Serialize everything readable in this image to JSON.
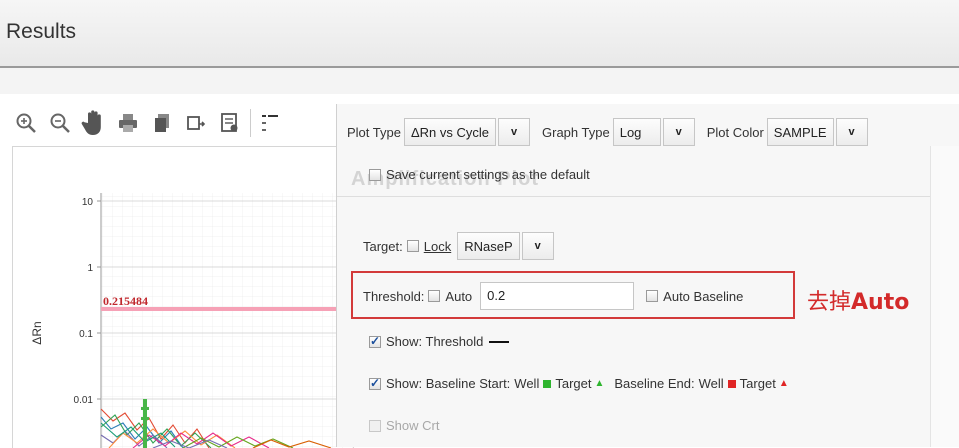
{
  "header": {
    "title": "Results"
  },
  "toolbar": {
    "icons": [
      "zoom-in-icon",
      "zoom-out-icon",
      "pan-hand-icon",
      "print-icon",
      "copy-icon",
      "export-icon",
      "report-icon",
      "legend-icon"
    ]
  },
  "plot": {
    "y_axis_label": "ΔRn",
    "y_ticks": [
      "10",
      "1",
      "0.1",
      "0.01"
    ],
    "threshold_value_label": "0.215484",
    "threshold_color": "#f6a1b6"
  },
  "options": {
    "plot_type_label": "Plot Type",
    "plot_type_value": "ΔRn vs Cycle",
    "graph_type_label": "Graph Type",
    "graph_type_value": "Log",
    "plot_color_label": "Plot Color",
    "plot_color_value": "SAMPLE",
    "save_default_label": "Save current settings as the default",
    "panel_ghost_title": "Amplification Plot",
    "target_label": "Target:",
    "lock_label": "Lock",
    "target_value": "RNaseP",
    "threshold_label": "Threshold:",
    "auto_label": "Auto",
    "threshold_value": "0.2",
    "auto_baseline_label": "Auto Baseline",
    "show_threshold_label": "Show: Threshold",
    "show_baseline_label": "Show: Baseline Start:",
    "well_label": "Well",
    "target_word": "Target",
    "baseline_end_label": "Baseline End:",
    "well_end_label": "Well",
    "target_end_label": "Target",
    "show_crt_label": "Show Crt",
    "arrow_glyph": "v"
  },
  "annotation": {
    "text_cn": "去掉",
    "text_auto": "Auto",
    "color": "#d32a2a"
  },
  "colors": {
    "start_marker": "#2fb52f",
    "end_marker": "#e02525",
    "box_border": "#d33a3a"
  }
}
